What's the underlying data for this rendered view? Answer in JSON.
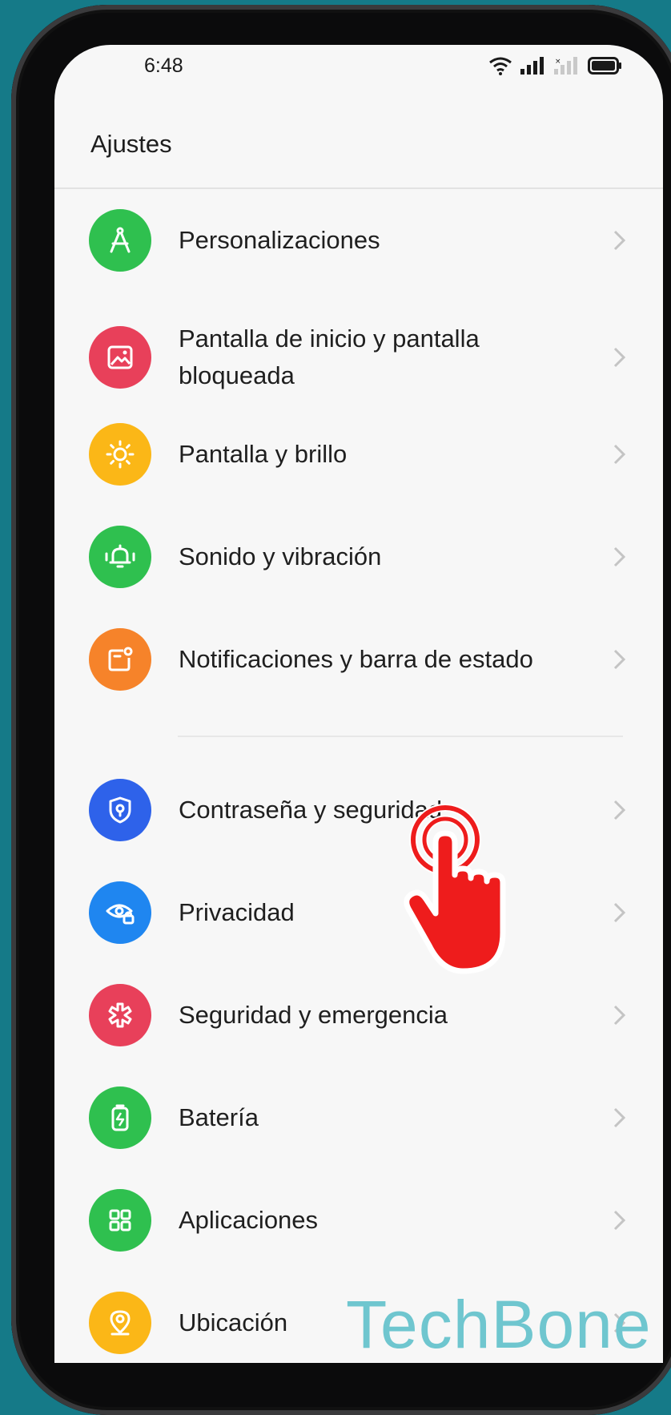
{
  "status_bar": {
    "time": "6:48"
  },
  "header": {
    "title": "Ajustes"
  },
  "settings": [
    {
      "label": "Personalizaciones",
      "icon": "compass-icon",
      "color": "#2fc04f"
    },
    {
      "label": "Pantalla de inicio y pantalla bloqueada",
      "icon": "image-icon",
      "color": "#e8405a"
    },
    {
      "label": "Pantalla y brillo",
      "icon": "sun-icon",
      "color": "#fbb717"
    },
    {
      "label": "Sonido y vibración",
      "icon": "bell-vibrate-icon",
      "color": "#2fc04f"
    },
    {
      "label": "Notificaciones y barra de estado",
      "icon": "notification-icon",
      "color": "#f6832a"
    },
    {
      "label": "Contraseña y seguridad",
      "icon": "shield-lock-icon",
      "color": "#2e62ea"
    },
    {
      "label": "Privacidad",
      "icon": "eye-lock-icon",
      "color": "#1f86f0"
    },
    {
      "label": "Seguridad y emergencia",
      "icon": "asterisk-icon",
      "color": "#e8405a"
    },
    {
      "label": "Batería",
      "icon": "battery-icon",
      "color": "#2fc04f"
    },
    {
      "label": "Aplicaciones",
      "icon": "apps-grid-icon",
      "color": "#2fc04f"
    },
    {
      "label": "Ubicación",
      "icon": "location-pin-icon",
      "color": "#fbb717"
    }
  ],
  "watermark": "TechBone"
}
